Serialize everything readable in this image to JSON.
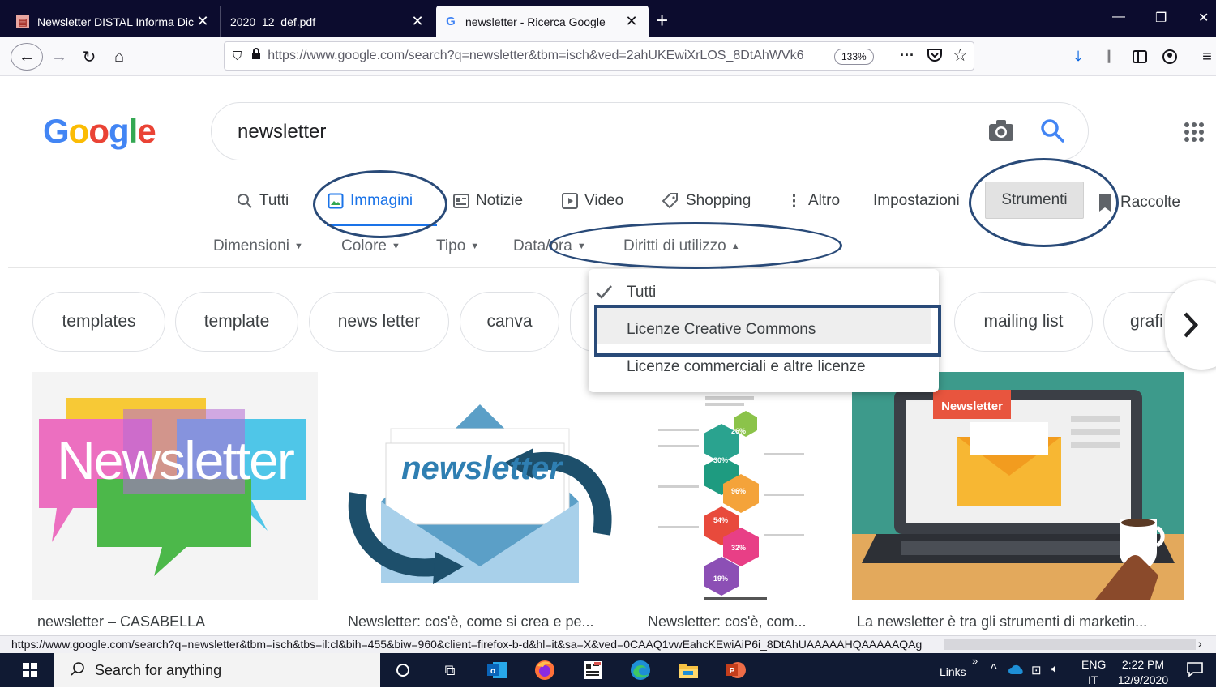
{
  "browser": {
    "tabs": [
      {
        "title": "Newsletter DISTAL Informa Dic",
        "favicon": "pdf-document-icon"
      },
      {
        "title": "2020_12_def.pdf"
      },
      {
        "title": "newsletter - Ricerca Google",
        "favicon": "google-g-icon"
      }
    ],
    "url": "https://www.google.com/search?q=newsletter&tbm=isch&ved=2ahUKEwiXrLOS_8DtAhWVk6",
    "url_domain": "google.com",
    "zoom": "133%"
  },
  "google": {
    "logo_text": "Google",
    "query": "newsletter",
    "tabs": [
      {
        "label": "Tutti"
      },
      {
        "label": "Immagini"
      },
      {
        "label": "Notizie"
      },
      {
        "label": "Video"
      },
      {
        "label": "Shopping"
      },
      {
        "label": "Altro"
      }
    ],
    "settings_label": "Impostazioni",
    "tools_label": "Strumenti",
    "collections_label": "Raccolte",
    "filters": [
      {
        "label": "Dimensioni"
      },
      {
        "label": "Colore"
      },
      {
        "label": "Tipo"
      },
      {
        "label": "Data/ora"
      },
      {
        "label": "Diritti di utilizzo"
      }
    ],
    "usage_rights_menu": [
      {
        "label": "Tutti",
        "selected": true
      },
      {
        "label": "Licenze Creative Commons"
      },
      {
        "label": "Licenze commerciali e altre licenze"
      }
    ],
    "chips": [
      "templates",
      "template",
      "news letter",
      "canva",
      "mailing list",
      "grafi"
    ],
    "results": [
      {
        "caption": "newsletter – CASABELLA",
        "image_text": "Newsletter"
      },
      {
        "caption": "Newsletter: cos'è, come si crea e pe...",
        "image_text": "newsletter"
      },
      {
        "caption": "Newsletter: cos'è, com...",
        "image_text": [
          "26%",
          "30%",
          "96%",
          "54%",
          "32%",
          "19%"
        ]
      },
      {
        "caption": "La newsletter è tra gli strumenti di marketin...",
        "image_text": "Newsletter"
      }
    ]
  },
  "status_url": "https://www.google.com/search?q=newsletter&tbm=isch&tbs=il:cl&bih=455&biw=960&client=firefox-b-d&hl=it&sa=X&ved=0CAAQ1vwEahcKEwiAiP6i_8DtAhUAAAAAHQAAAAAQAg",
  "taskbar": {
    "search_placeholder": "Search for anything",
    "links_label": "Links",
    "lang_primary": "ENG",
    "lang_secondary": "IT",
    "time": "2:22 PM",
    "date": "12/9/2020"
  }
}
